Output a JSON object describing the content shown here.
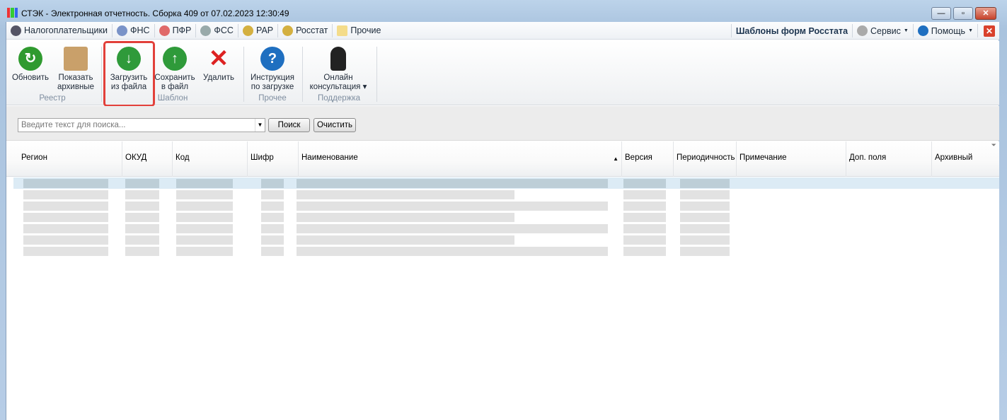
{
  "window": {
    "title": "СТЭК - Электронная отчетность. Сборка 409 от 07.02.2023 12:30:49",
    "minimize": "—",
    "maximize": "▫",
    "close": "✕"
  },
  "menu": {
    "items": [
      {
        "label": "Налогоплательщики",
        "icon": "users-icon"
      },
      {
        "label": "ФНС",
        "icon": "fns-emblem-icon"
      },
      {
        "label": "ПФР",
        "icon": "pfr-emblem-icon"
      },
      {
        "label": "ФСС",
        "icon": "fss-emblem-icon"
      },
      {
        "label": "РАР",
        "icon": "rar-emblem-icon"
      },
      {
        "label": "Росстат",
        "icon": "rosstat-emblem-icon"
      },
      {
        "label": "Прочие",
        "icon": "folder-icon"
      }
    ],
    "section_title": "Шаблоны форм Росстата",
    "service": "Сервис",
    "help": "Помощь",
    "close": "✕"
  },
  "ribbon": {
    "buttons": [
      {
        "line1": "Обновить",
        "line2": ""
      },
      {
        "line1": "Показать",
        "line2": "архивные"
      },
      {
        "line1": "Загрузить",
        "line2": "из файла"
      },
      {
        "line1": "Сохранить",
        "line2": "в файл"
      },
      {
        "line1": "Удалить",
        "line2": ""
      },
      {
        "line1": "Инструкция",
        "line2": "по загрузке"
      },
      {
        "line1": "Онлайн",
        "line2": "консультация ▾"
      }
    ],
    "groups": [
      "Реестр",
      "Шаблон",
      "Прочее",
      "Поддержка"
    ]
  },
  "search": {
    "placeholder": "Введите текст для поиска...",
    "search_label": "Поиск",
    "clear_label": "Очистить"
  },
  "grid": {
    "columns": [
      "Регион",
      "ОКУД",
      "Код",
      "Шифр",
      "Наименование",
      "Версия",
      "Периодичность",
      "Примечание",
      "Доп. поля",
      "Архивный"
    ],
    "sort_indicator": "▲",
    "filter_icon": "⏷"
  },
  "colors": {
    "highlight": "#e2403a",
    "selected_row": "#dcebf5"
  }
}
